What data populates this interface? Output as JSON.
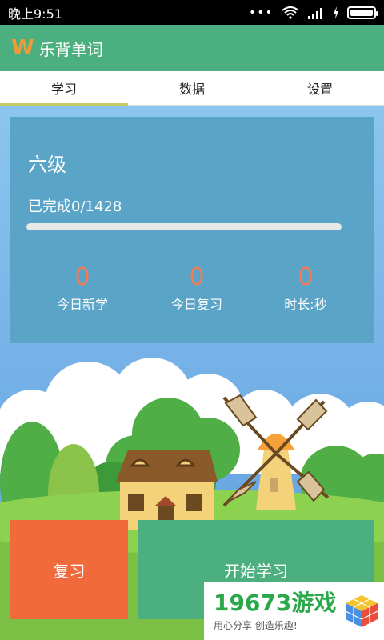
{
  "status_bar": {
    "time": "晚上9:51",
    "dots": "•••"
  },
  "app_bar": {
    "logo": "W",
    "title": "乐背单词"
  },
  "tabs": [
    {
      "label": "学习",
      "active": true
    },
    {
      "label": "数据",
      "active": false
    },
    {
      "label": "设置",
      "active": false
    }
  ],
  "card": {
    "level": "六级",
    "progress_text": "已完成0/1428",
    "progress_fraction": 0,
    "stats": [
      {
        "value": "0",
        "label": "今日新学"
      },
      {
        "value": "0",
        "label": "今日复习"
      },
      {
        "value": "0",
        "label": "时长:秒"
      }
    ]
  },
  "actions": {
    "review_label": "复习",
    "start_label": "开始学习"
  },
  "watermark": {
    "brand": "19673游戏",
    "slogan": "用心分享 创造乐趣!"
  },
  "colors": {
    "accent_green": "#4caf7f",
    "review_orange": "#f06a3b",
    "stat_value": "#f27a55",
    "card_bg": "#5aa4c7"
  }
}
